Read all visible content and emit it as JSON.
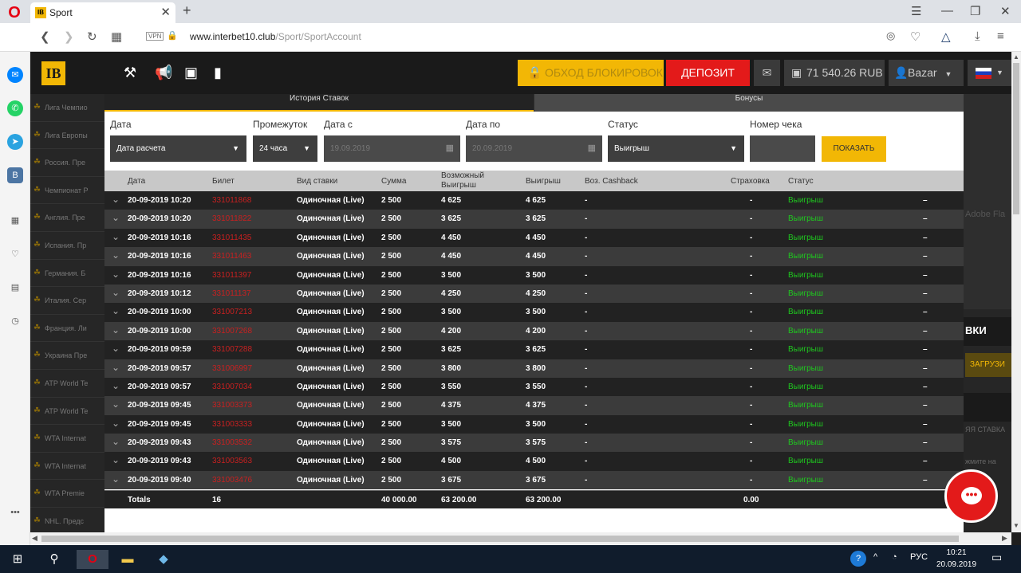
{
  "browser": {
    "tab_title": "Sport",
    "favicon_text": "IB",
    "url_host": "www.interbet10.club",
    "url_path": "/Sport/SportAccount",
    "vpn_label": "VPN"
  },
  "header": {
    "logo": "IB",
    "bypass_label": "ОБХОД БЛОКИРОВОК",
    "deposit_label": "ДЕПОЗИТ",
    "balance": "71 540.26 RUB",
    "username": "Bazar"
  },
  "leagues": [
    "Лига Чемпио",
    "Лига Европы",
    "Россия. Пре",
    "Чемпионат Р",
    "Англия. Пре",
    "Испания. Пр",
    "Германия. Б",
    "Италия. Сер",
    "Франция. Ли",
    "Украина Пре",
    "ATP World Te",
    "ATP World Te",
    "WTA Internat",
    "WTA Internat",
    "WTA Premie",
    "NHL. Предс"
  ],
  "right_panel": {
    "adobe": "Adobe Fla",
    "bki": "ВКИ",
    "load": "ЗАГРУЗИ",
    "bet": "ЯЯ СТАВКА",
    "press": "жмите на"
  },
  "modal": {
    "tab_history": "История Ставок",
    "tab_bonus": "Бонусы",
    "filters": {
      "date_label": "Дата",
      "date_value": "Дата расчета",
      "period_label": "Промежуток",
      "period_value": "24 часа",
      "from_label": "Дата с",
      "from_value": "19.09.2019",
      "to_label": "Дата по",
      "to_value": "20.09.2019",
      "status_label": "Статус",
      "status_value": "Выигрыш",
      "check_label": "Номер чека",
      "check_value": "",
      "show_button": "ПОКАЗАТЬ"
    },
    "columns": {
      "date": "Дата",
      "ticket": "Билет",
      "bet_type": "Вид ставки",
      "amount": "Сумма",
      "possible": "Возможный Выигрыш",
      "win": "Выигрыш",
      "cashback": "Воз. Cashback",
      "insurance": "Страховка",
      "status": "Статус"
    },
    "rows": [
      {
        "date": "20-09-2019 10:20",
        "ticket": "331011868",
        "type": "Одиночная (Live)",
        "amount": "2 500",
        "possible": "4 625",
        "win": "4 625",
        "cashback": "-",
        "insurance": "-",
        "status": "Выигрыш",
        "extra": "–"
      },
      {
        "date": "20-09-2019 10:20",
        "ticket": "331011822",
        "type": "Одиночная (Live)",
        "amount": "2 500",
        "possible": "3 625",
        "win": "3 625",
        "cashback": "-",
        "insurance": "-",
        "status": "Выигрыш",
        "extra": "–"
      },
      {
        "date": "20-09-2019 10:16",
        "ticket": "331011435",
        "type": "Одиночная (Live)",
        "amount": "2 500",
        "possible": "4 450",
        "win": "4 450",
        "cashback": "-",
        "insurance": "-",
        "status": "Выигрыш",
        "extra": "–"
      },
      {
        "date": "20-09-2019 10:16",
        "ticket": "331011463",
        "type": "Одиночная (Live)",
        "amount": "2 500",
        "possible": "4 450",
        "win": "4 450",
        "cashback": "-",
        "insurance": "-",
        "status": "Выигрыш",
        "extra": "–"
      },
      {
        "date": "20-09-2019 10:16",
        "ticket": "331011397",
        "type": "Одиночная (Live)",
        "amount": "2 500",
        "possible": "3 500",
        "win": "3 500",
        "cashback": "-",
        "insurance": "-",
        "status": "Выигрыш",
        "extra": "–"
      },
      {
        "date": "20-09-2019 10:12",
        "ticket": "331011137",
        "type": "Одиночная (Live)",
        "amount": "2 500",
        "possible": "4 250",
        "win": "4 250",
        "cashback": "-",
        "insurance": "-",
        "status": "Выигрыш",
        "extra": "–"
      },
      {
        "date": "20-09-2019 10:00",
        "ticket": "331007213",
        "type": "Одиночная (Live)",
        "amount": "2 500",
        "possible": "3 500",
        "win": "3 500",
        "cashback": "-",
        "insurance": "-",
        "status": "Выигрыш",
        "extra": "–"
      },
      {
        "date": "20-09-2019 10:00",
        "ticket": "331007268",
        "type": "Одиночная (Live)",
        "amount": "2 500",
        "possible": "4 200",
        "win": "4 200",
        "cashback": "-",
        "insurance": "-",
        "status": "Выигрыш",
        "extra": "–"
      },
      {
        "date": "20-09-2019 09:59",
        "ticket": "331007288",
        "type": "Одиночная (Live)",
        "amount": "2 500",
        "possible": "3 625",
        "win": "3 625",
        "cashback": "-",
        "insurance": "-",
        "status": "Выигрыш",
        "extra": "–"
      },
      {
        "date": "20-09-2019 09:57",
        "ticket": "331006997",
        "type": "Одиночная (Live)",
        "amount": "2 500",
        "possible": "3 800",
        "win": "3 800",
        "cashback": "-",
        "insurance": "-",
        "status": "Выигрыш",
        "extra": "–"
      },
      {
        "date": "20-09-2019 09:57",
        "ticket": "331007034",
        "type": "Одиночная (Live)",
        "amount": "2 500",
        "possible": "3 550",
        "win": "3 550",
        "cashback": "-",
        "insurance": "-",
        "status": "Выигрыш",
        "extra": "–"
      },
      {
        "date": "20-09-2019 09:45",
        "ticket": "331003373",
        "type": "Одиночная (Live)",
        "amount": "2 500",
        "possible": "4 375",
        "win": "4 375",
        "cashback": "-",
        "insurance": "-",
        "status": "Выигрыш",
        "extra": "–"
      },
      {
        "date": "20-09-2019 09:45",
        "ticket": "331003333",
        "type": "Одиночная (Live)",
        "amount": "2 500",
        "possible": "3 500",
        "win": "3 500",
        "cashback": "-",
        "insurance": "-",
        "status": "Выигрыш",
        "extra": "–"
      },
      {
        "date": "20-09-2019 09:43",
        "ticket": "331003532",
        "type": "Одиночная (Live)",
        "amount": "2 500",
        "possible": "3 575",
        "win": "3 575",
        "cashback": "-",
        "insurance": "-",
        "status": "Выигрыш",
        "extra": "–"
      },
      {
        "date": "20-09-2019 09:43",
        "ticket": "331003563",
        "type": "Одиночная (Live)",
        "amount": "2 500",
        "possible": "4 500",
        "win": "4 500",
        "cashback": "-",
        "insurance": "-",
        "status": "Выигрыш",
        "extra": "–"
      },
      {
        "date": "20-09-2019 09:40",
        "ticket": "331003476",
        "type": "Одиночная (Live)",
        "amount": "2 500",
        "possible": "3 675",
        "win": "3 675",
        "cashback": "-",
        "insurance": "-",
        "status": "Выигрыш",
        "extra": "–"
      }
    ],
    "totals": {
      "label": "Totals",
      "count": "16",
      "amount": "40 000.00",
      "possible": "63 200.00",
      "win": "63 200.00",
      "insurance": "0.00"
    }
  },
  "taskbar": {
    "lang": "РУС",
    "time": "10:21",
    "date": "20.09.2019"
  },
  "colors": {
    "accent": "#f2b705",
    "deposit": "#e31a1a",
    "ticket": "#c82020",
    "win_status": "#1fc81f"
  }
}
